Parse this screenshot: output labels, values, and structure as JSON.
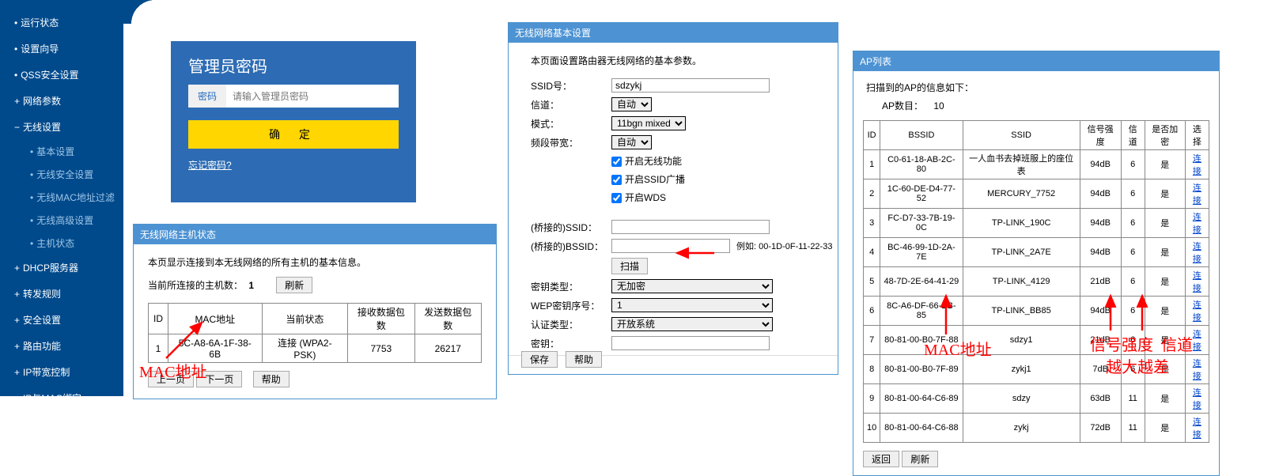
{
  "sidebar": {
    "items": [
      {
        "label": "运行状态",
        "type": "item"
      },
      {
        "label": "设置向导",
        "type": "item"
      },
      {
        "label": "QSS安全设置",
        "type": "item"
      },
      {
        "label": "网络参数",
        "type": "expandable"
      },
      {
        "label": "无线设置",
        "type": "expanded"
      },
      {
        "label": "基本设置",
        "type": "sub"
      },
      {
        "label": "无线安全设置",
        "type": "sub"
      },
      {
        "label": "无线MAC地址过滤",
        "type": "sub"
      },
      {
        "label": "无线高级设置",
        "type": "sub"
      },
      {
        "label": "主机状态",
        "type": "sub"
      },
      {
        "label": "DHCP服务器",
        "type": "expandable"
      },
      {
        "label": "转发规则",
        "type": "expandable"
      },
      {
        "label": "安全设置",
        "type": "expandable"
      },
      {
        "label": "路由功能",
        "type": "expandable"
      },
      {
        "label": "IP带宽控制",
        "type": "expandable"
      },
      {
        "label": "IP与MAC绑定",
        "type": "expandable"
      }
    ]
  },
  "login": {
    "title": "管理员密码",
    "pwd_label": "密码",
    "placeholder": "请输入管理员密码",
    "confirm": "确 定",
    "forgot": "忘记密码?"
  },
  "hosts": {
    "header": "无线网络主机状态",
    "desc": "本页显示连接到本无线网络的所有主机的基本信息。",
    "count_label": "当前所连接的主机数：",
    "count": "1",
    "refresh": "刷新",
    "prev": "上一页",
    "next": "下一页",
    "help": "帮助",
    "cols": [
      "ID",
      "MAC地址",
      "当前状态",
      "接收数据包数",
      "发送数据包数"
    ],
    "rows": [
      [
        "1",
        "5C-A8-6A-1F-38-6B",
        "连接 (WPA2-PSK)",
        "7753",
        "26217"
      ]
    ]
  },
  "wireless": {
    "header": "无线网络基本设置",
    "desc": "本页面设置路由器无线网络的基本参数。",
    "ssid_label": "SSID号：",
    "ssid": "sdzykj",
    "channel_label": "信道：",
    "channel": "自动",
    "mode_label": "模式：",
    "mode": "11bgn mixed",
    "band_label": "频段带宽：",
    "band": "自动",
    "cb1": "开启无线功能",
    "cb2": "开启SSID广播",
    "cb3": "开启WDS",
    "bridge_ssid_label": "(桥接的)SSID：",
    "bridge_ssid": "",
    "bridge_bssid_label": "(桥接的)BSSID：",
    "bridge_bssid": "",
    "example": "例如: 00-1D-0F-11-22-33",
    "scan": "扫描",
    "keytype_label": "密钥类型：",
    "keytype": "无加密",
    "wepidx_label": "WEP密钥序号：",
    "wepidx": "1",
    "authtype_label": "认证类型：",
    "authtype": "开放系统",
    "key_label": "密钥：",
    "key": "",
    "save": "保存",
    "help": "帮助"
  },
  "aplist": {
    "header": "AP列表",
    "desc": "扫描到的AP的信息如下：",
    "count_label": "AP数目：",
    "count": "10",
    "back": "返回",
    "refresh": "刷新",
    "cols": [
      "ID",
      "BSSID",
      "SSID",
      "信号强度",
      "信道",
      "是否加密",
      "选择"
    ],
    "connect": "连接",
    "rows": [
      [
        "1",
        "C0-61-18-AB-2C-80",
        "一人血书去掉班服上的座位表",
        "94dB",
        "6",
        "是"
      ],
      [
        "2",
        "1C-60-DE-D4-77-52",
        "MERCURY_7752",
        "94dB",
        "6",
        "是"
      ],
      [
        "3",
        "FC-D7-33-7B-19-0C",
        "TP-LINK_190C",
        "94dB",
        "6",
        "是"
      ],
      [
        "4",
        "BC-46-99-1D-2A-7E",
        "TP-LINK_2A7E",
        "94dB",
        "6",
        "是"
      ],
      [
        "5",
        "48-7D-2E-64-41-29",
        "TP-LINK_4129",
        "21dB",
        "6",
        "是"
      ],
      [
        "6",
        "8C-A6-DF-66-BB-85",
        "TP-LINK_BB85",
        "94dB",
        "6",
        "是"
      ],
      [
        "7",
        "80-81-00-B0-7F-88",
        "sdzy1",
        "21dB",
        "6",
        "是"
      ],
      [
        "8",
        "80-81-00-B0-7F-89",
        "zykj1",
        "7dB",
        "6",
        "是"
      ],
      [
        "9",
        "80-81-00-64-C6-89",
        "sdzy",
        "63dB",
        "11",
        "是"
      ],
      [
        "10",
        "80-81-00-64-C6-88",
        "zykj",
        "72dB",
        "11",
        "是"
      ]
    ]
  },
  "anno": {
    "mac1": "MAC地址",
    "mac2": "MAC地址",
    "sig": "信号强度",
    "chan": "信道",
    "note": "越大越差"
  }
}
